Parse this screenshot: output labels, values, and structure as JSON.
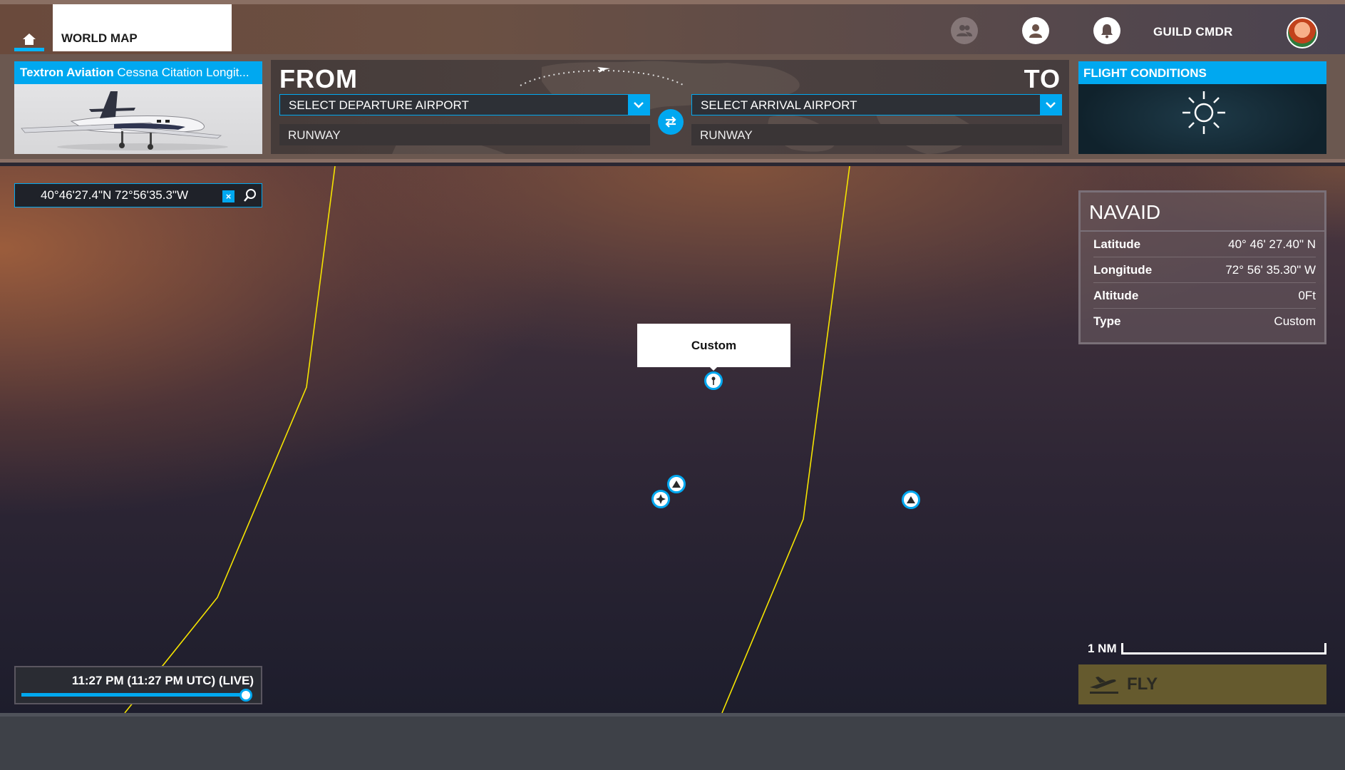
{
  "topbar": {
    "home_icon": "home-icon",
    "tab_label": "WORLD MAP",
    "friends_icon": "friends-icon",
    "profile_icon": "profile-icon",
    "notifications_icon": "bell-icon",
    "username": "GUILD CMDR",
    "avatar_icon": "avatar"
  },
  "aircraft": {
    "make": "Textron Aviation",
    "model": "Cessna Citation Longit..."
  },
  "route": {
    "from_label": "FROM",
    "to_label": "TO",
    "departure_placeholder": "SELECT DEPARTURE AIRPORT",
    "arrival_placeholder": "SELECT ARRIVAL AIRPORT",
    "departure_runway": "RUNWAY",
    "arrival_runway": "RUNWAY",
    "swap_icon": "swap-icon"
  },
  "conditions": {
    "title": "FLIGHT CONDITIONS",
    "weather_icon": "sun-icon"
  },
  "search": {
    "value": "40°46'27.4\"N 72°56'35.3\"W",
    "clear_icon": "close-icon",
    "search_icon": "search-icon"
  },
  "navaid": {
    "title": "NAVAID",
    "rows": [
      {
        "key": "Latitude",
        "value": "40° 46' 27.40\" N"
      },
      {
        "key": "Longitude",
        "value": "72° 56' 35.30\" W"
      },
      {
        "key": "Altitude",
        "value": "0Ft"
      },
      {
        "key": "Type",
        "value": "Custom"
      }
    ]
  },
  "map": {
    "callout_label": "Custom",
    "markers": [
      "pin-icon",
      "navaid-triangle-icon",
      "navaid-compass-icon",
      "navaid-triangle-icon"
    ]
  },
  "time": {
    "label": "11:27 PM (11:27 PM UTC) (LIVE)",
    "progress": 1.0
  },
  "scale": {
    "label": "1 NM"
  },
  "fly": {
    "label": "FLY",
    "icon": "takeoff-icon"
  },
  "colors": {
    "accent": "#00a8f0",
    "fly_button": "#655a2e",
    "border_line": "#f5e400"
  }
}
